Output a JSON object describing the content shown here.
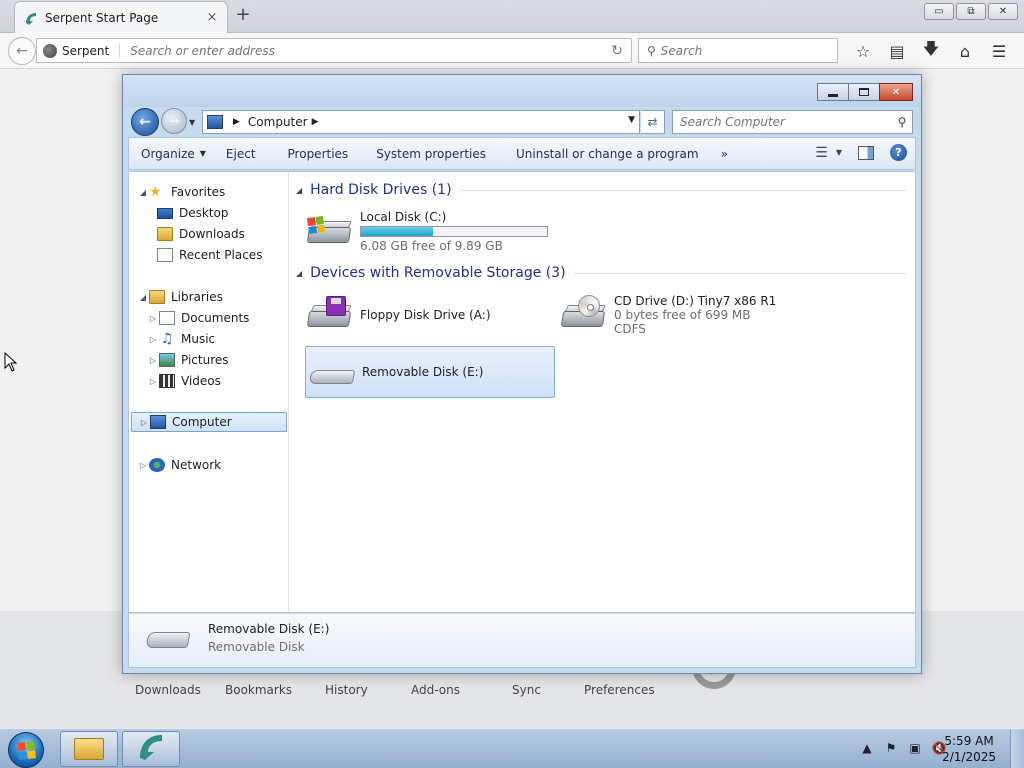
{
  "browser": {
    "tab_title": "Serpent Start Page",
    "tab_close": "×",
    "new_tab": "+",
    "identity": "Serpent",
    "url_placeholder": "Search or enter address",
    "search_placeholder": "Search",
    "win_minimize": "▭",
    "win_restore": "⧉",
    "win_close": "✕"
  },
  "launcher": {
    "items": [
      "Downloads",
      "Bookmarks",
      "History",
      "Add-ons",
      "Sync",
      "Preferences"
    ]
  },
  "explorer": {
    "address": {
      "crumb": "Computer"
    },
    "search_placeholder": "Search Computer",
    "toolbar": {
      "organize": "Organize",
      "eject": "Eject",
      "properties": "Properties",
      "system_properties": "System properties",
      "uninstall": "Uninstall or change a program",
      "more": "»",
      "help": "?"
    },
    "nav": {
      "favorites": "Favorites",
      "desktop": "Desktop",
      "downloads": "Downloads",
      "recent": "Recent Places",
      "libraries": "Libraries",
      "documents": "Documents",
      "music": "Music",
      "pictures": "Pictures",
      "videos": "Videos",
      "computer": "Computer",
      "network": "Network"
    },
    "groups": {
      "hdd": "Hard Disk Drives (1)",
      "removable": "Devices with Removable Storage (3)"
    },
    "drives": {
      "c": {
        "name": "Local Disk (C:)",
        "free": "6.08 GB free of 9.89 GB",
        "used_fraction": 0.385
      },
      "a": {
        "name": "Floppy Disk Drive (A:)"
      },
      "d": {
        "name": "CD Drive (D:) Tiny7 x86 R1",
        "free": "0 bytes free of 699 MB",
        "fs": "CDFS"
      },
      "e": {
        "name": "Removable Disk (E:)"
      }
    },
    "details": {
      "name": "Removable Disk (E:)",
      "type": "Removable Disk"
    }
  },
  "taskbar": {
    "time": "5:59 AM",
    "date": "2/1/2025",
    "tray_arrow": "▲"
  }
}
